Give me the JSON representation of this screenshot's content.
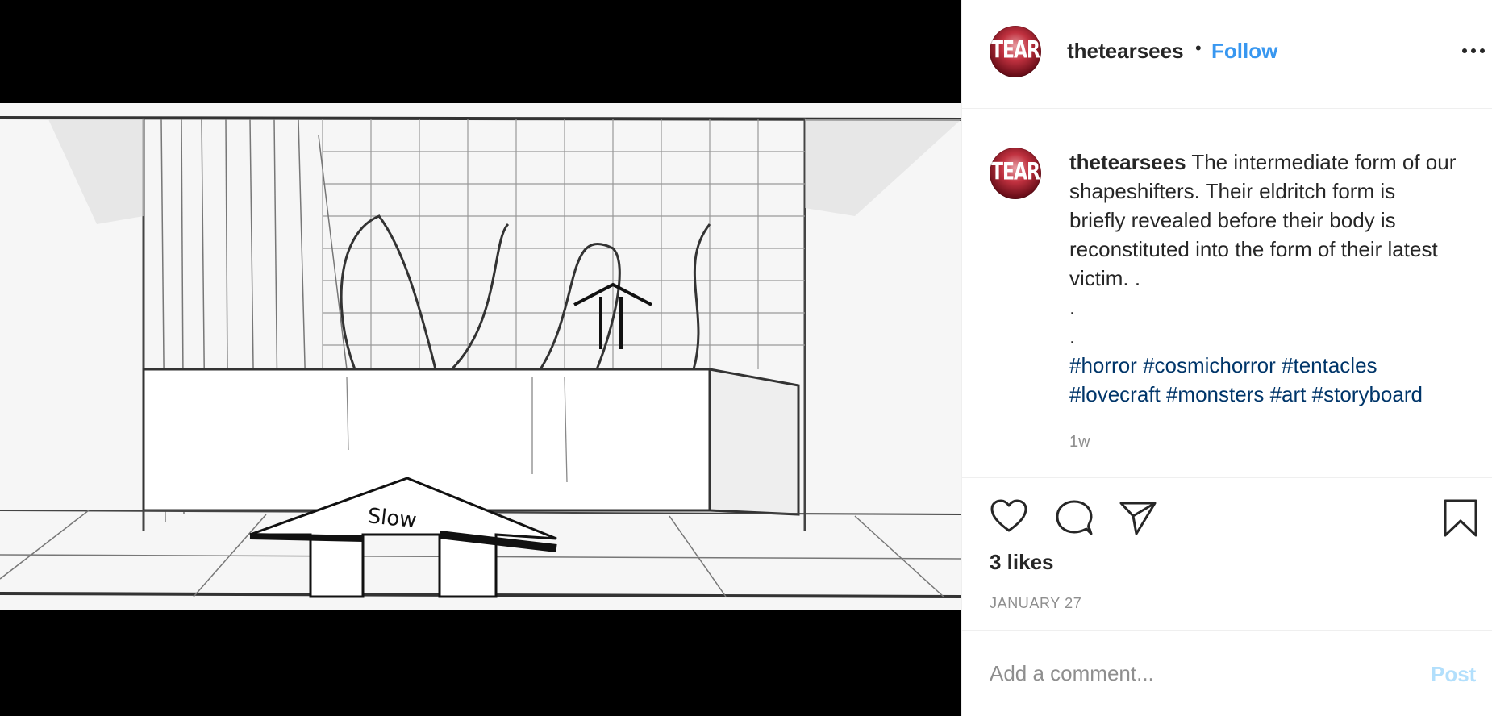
{
  "post": {
    "username": "thetearsees",
    "avatar_text": "TEAR",
    "separator": "•",
    "follow_label": "Follow",
    "more_icon": "more-horizontal-icon",
    "caption": {
      "username": "thetearsees",
      "text_lines": [
        "The intermediate form of our",
        "shapeshifters. Their eldritch form is",
        "briefly revealed before their body is",
        "reconstituted into the form of their latest",
        "victim. ."
      ],
      "dot_lines": [
        ".",
        "."
      ],
      "hashtags_line1": [
        "#horror",
        "#cosmichorror",
        "#tentacles"
      ],
      "hashtags_line2": [
        "#lovecraft",
        "#monsters",
        "#art",
        "#storyboard"
      ]
    },
    "time_ago": "1w",
    "likes": "3 likes",
    "date": "JANUARY 27",
    "comment_placeholder": "Add a comment...",
    "post_label": "Post"
  },
  "media": {
    "sketch_arrow_text": "Slow"
  },
  "colors": {
    "link_blue": "#3897f0",
    "hashtag_blue": "#003569",
    "muted_gray": "#8e8e8e",
    "post_disabled": "#b2dffc",
    "text": "#262626"
  },
  "icons": [
    "heart-icon",
    "comment-icon",
    "share-icon",
    "bookmark-icon"
  ]
}
